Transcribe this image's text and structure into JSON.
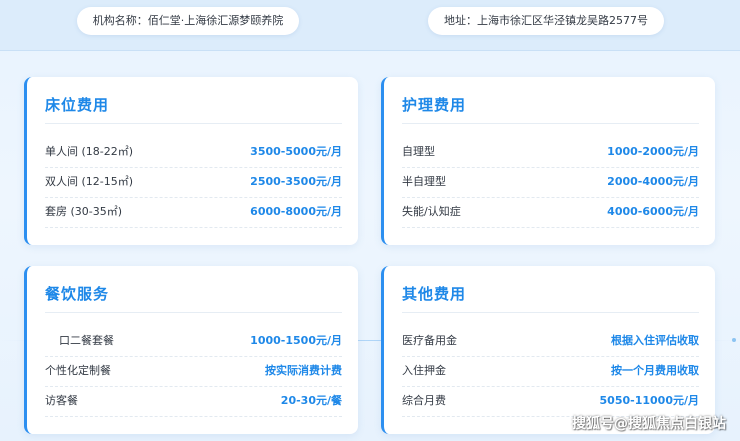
{
  "header": {
    "institution": "机构名称：佰仁堂·上海徐汇源梦颐养院",
    "address": "地址：上海市徐汇区华泾镇龙吴路2577号"
  },
  "cards": [
    {
      "title": "床位费用",
      "rows": [
        {
          "label": "单人间 (18-22㎡)",
          "value": "3500-5000元/月"
        },
        {
          "label": "双人间 (12-15㎡)",
          "value": "2500-3500元/月"
        },
        {
          "label": "套房 (30-35㎡)",
          "value": "6000-8000元/月"
        }
      ]
    },
    {
      "title": "护理费用",
      "rows": [
        {
          "label": "自理型",
          "value": "1000-2000元/月"
        },
        {
          "label": "半自理型",
          "value": "2000-4000元/月"
        },
        {
          "label": "失能/认知症",
          "value": "4000-6000元/月"
        }
      ]
    },
    {
      "title": "餐饮服务",
      "rows": [
        {
          "label": "口二餐套餐",
          "value": "1000-1500元/月"
        },
        {
          "label": "个性化定制餐",
          "value": "按实际消费计费"
        },
        {
          "label": "访客餐",
          "value": "20-30元/餐"
        }
      ]
    },
    {
      "title": "其他费用",
      "rows": [
        {
          "label": "医疗备用金",
          "value": "根据入住评估收取"
        },
        {
          "label": "入住押金",
          "value": "按一个月费用收取"
        },
        {
          "label": "综合月费",
          "value": "5050-11000元/月"
        }
      ]
    }
  ],
  "watermark": "搜狐号@搜狐焦点白银站",
  "colors": {
    "accent": "#1e88e8",
    "background": "#eaf4fe"
  }
}
